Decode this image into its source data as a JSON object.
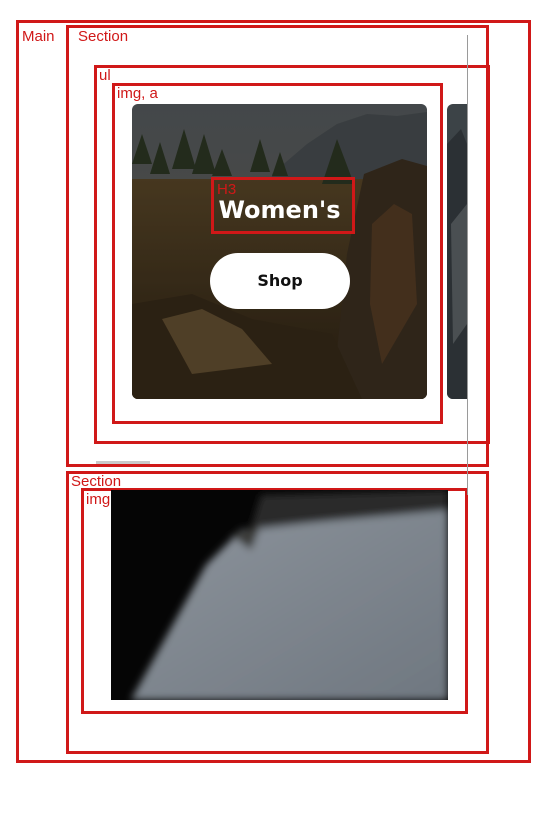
{
  "annotations": {
    "main": "Main",
    "section_top": "Section",
    "list": "ul",
    "card_link": "img, a",
    "heading": "H3",
    "section_bottom": "Section",
    "image": "img"
  },
  "carousel": {
    "card_title": "Women's",
    "button_label": "Shop"
  }
}
